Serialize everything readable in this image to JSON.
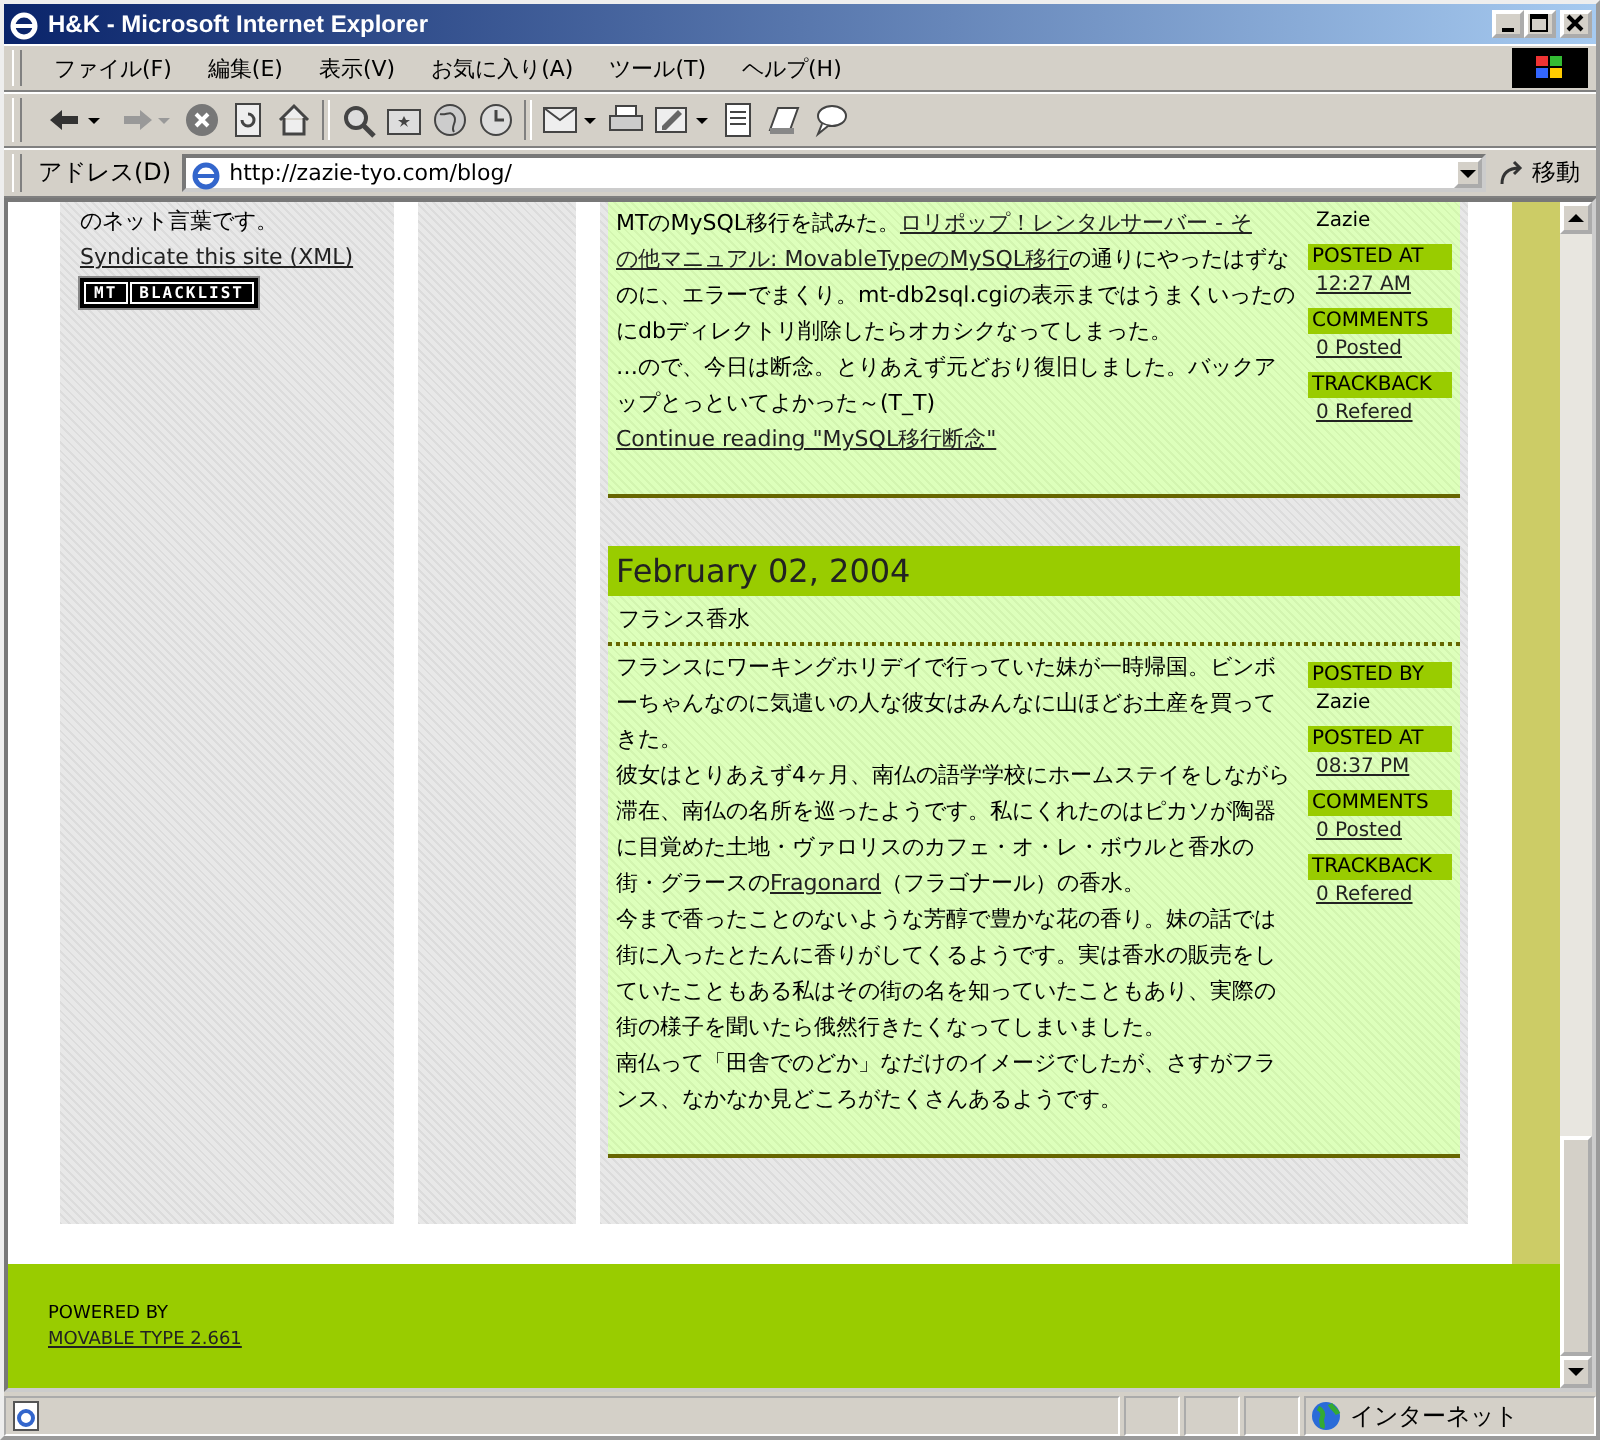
{
  "window": {
    "title": "H&K - Microsoft Internet Explorer"
  },
  "menu": [
    "ファイル(F)",
    "編集(E)",
    "表示(V)",
    "お気に入り(A)",
    "ツール(T)",
    "ヘルプ(H)"
  ],
  "address_bar": {
    "label": "アドレス(D)",
    "value": "http://zazie-tyo.com/blog/",
    "go_button": "移動"
  },
  "sidebar": {
    "text": "のネット言葉です。",
    "syndicate_link": "Syndicate this site (XML)",
    "badge": [
      "MT",
      "BLACKLIST"
    ]
  },
  "posts": [
    {
      "paragraphs": [
        [
          {
            "text": "MTのMySQL移行を試みた。",
            "link": false
          },
          {
            "text": "ロリポップ！レンタルサーバー - そ",
            "link": true
          },
          {
            "text": "の他マニュアル: MovableTypeのMySQL移行",
            "link": true
          },
          {
            "text": "の通りにやったはずなのに、エラーでまくり。mt-db2sql.cgiの表示まではうまくいったのにdbディレクトリ削除したらオカシクなってしまった。",
            "link": false
          }
        ],
        [
          {
            "text": "…ので、今日は断念。とりあえず元どおり復旧しました。バックアップとっといてよかった～(T_T)",
            "link": false
          }
        ]
      ],
      "continue_link": "Continue reading \"MySQL移行断念\"",
      "meta": [
        {
          "value": "Zazie",
          "link": false
        },
        {
          "label": "POSTED AT",
          "value": "12:27 AM",
          "link": true
        },
        {
          "label": "COMMENTS",
          "value": "0 Posted",
          "link": true
        },
        {
          "label": "TRACKBACK",
          "value": "0 Refered",
          "link": true
        }
      ]
    },
    {
      "date": "February 02, 2004",
      "title": "フランス香水",
      "paragraphs": [
        [
          {
            "text": "フランスにワーキングホリデイで行っていた妹が一時帰国。ビンボーちゃんなのに気遣いの人な彼女はみんなに山ほどお土産を買ってきた。",
            "link": false
          }
        ],
        [
          {
            "text": "彼女はとりあえず4ヶ月、南仏の語学学校にホームステイをしながら滞在、南仏の名所を巡ったようです。私にくれたのはピカソが陶器に目覚めた土地・ヴァロリスのカフェ・オ・レ・ボウルと香水の街・グラースの",
            "link": false
          },
          {
            "text": "Fragonard",
            "link": true
          },
          {
            "text": "（フラゴナール）の香水。",
            "link": false
          }
        ],
        [
          {
            "text": "今まで香ったことのないような芳醇で豊かな花の香り。妹の話では街に入ったとたんに香りがしてくるようです。実は香水の販売をしていたこともある私はその街の名を知っていたこともあり、実際の街の様子を聞いたら俄然行きたくなってしまいました。",
            "link": false
          }
        ],
        [
          {
            "text": "南仏って「田舎でのどか」なだけのイメージでしたが、さすがフランス、なかなか見どころがたくさんあるようです。",
            "link": false
          }
        ]
      ],
      "meta": [
        {
          "label": "POSTED BY",
          "value": "Zazie",
          "link": false
        },
        {
          "label": "POSTED AT",
          "value": "08:37 PM",
          "link": true
        },
        {
          "label": "COMMENTS",
          "value": "0 Posted",
          "link": true
        },
        {
          "label": "TRACKBACK",
          "value": "0 Refered",
          "link": true
        }
      ]
    }
  ],
  "footer": {
    "label": "POWERED BY",
    "link": "MOVABLE TYPE 2.661"
  },
  "status_bar": {
    "zone": "インターネット"
  }
}
